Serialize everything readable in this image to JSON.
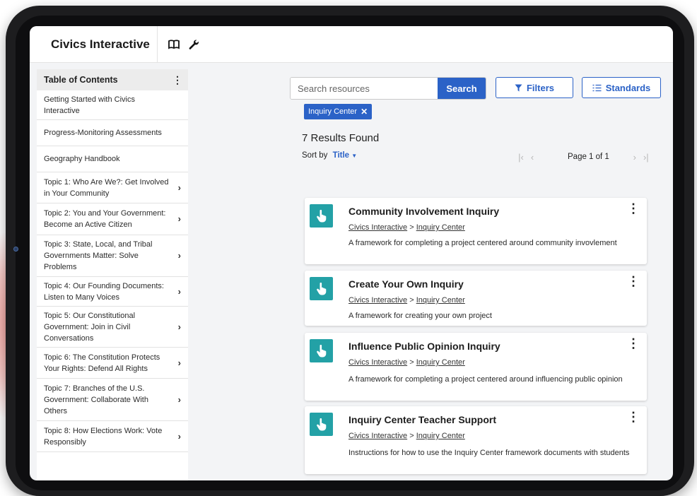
{
  "app": {
    "title": "Civics Interactive"
  },
  "icons": {
    "book": "book-icon",
    "wrench": "wrench-icon",
    "hand_pointer": "hand-pointer-icon",
    "filter": "filter-icon",
    "list": "list-icon"
  },
  "colors": {
    "accent": "#2b62c7",
    "resource_icon": "#23a1a6"
  },
  "toc": {
    "title": "Table of Contents",
    "items": [
      {
        "label": "Getting Started with Civics Interactive",
        "has_children": false
      },
      {
        "label": "Progress-Monitoring Assessments",
        "has_children": false
      },
      {
        "label": "Geography Handbook",
        "has_children": false
      },
      {
        "label": "Topic 1: Who Are We?: Get Involved in Your Community",
        "has_children": true
      },
      {
        "label": "Topic 2: You and Your Government: Become an Active Citizen",
        "has_children": true
      },
      {
        "label": "Topic 3: State, Local, and Tribal Governments Matter: Solve Problems",
        "has_children": true
      },
      {
        "label": "Topic 4: Our Founding Documents: Listen to Many Voices",
        "has_children": true
      },
      {
        "label": "Topic 5: Our Constitutional Government: Join in Civil Conversations",
        "has_children": true
      },
      {
        "label": "Topic 6: The Constitution Protects Your Rights: Defend All Rights",
        "has_children": true
      },
      {
        "label": "Topic 7: Branches of the U.S. Government: Collaborate With Others",
        "has_children": true
      },
      {
        "label": "Topic 8: How Elections Work: Vote Responsibly",
        "has_children": true
      }
    ]
  },
  "search": {
    "placeholder": "Search resources",
    "button": "Search",
    "filters_label": "Filters",
    "standards_label": "Standards",
    "active_filter": "Inquiry Center"
  },
  "results": {
    "count_label": "7 Results Found",
    "sort_label": "Sort by",
    "sort_value": "Title",
    "page_label": "Page 1 of 1",
    "items": [
      {
        "title": "Community Involvement Inquiry",
        "crumb_root": "Civics Interactive",
        "crumb_sep": ">",
        "crumb_leaf": "Inquiry Center",
        "description": "A framework for completing a project centered around community invovlement"
      },
      {
        "title": "Create Your Own Inquiry",
        "crumb_root": "Civics Interactive",
        "crumb_sep": ">",
        "crumb_leaf": "Inquiry Center",
        "description": "A framework for creating your own project"
      },
      {
        "title": "Influence Public Opinion Inquiry",
        "crumb_root": "Civics Interactive",
        "crumb_sep": ">",
        "crumb_leaf": "Inquiry Center",
        "description": "A framework for completing a project centered around influencing public opinion"
      },
      {
        "title": "Inquiry Center Teacher Support",
        "crumb_root": "Civics Interactive",
        "crumb_sep": ">",
        "crumb_leaf": "Inquiry Center",
        "description": "Instructions for how to use the Inquiry Center framework documents with students"
      }
    ]
  }
}
